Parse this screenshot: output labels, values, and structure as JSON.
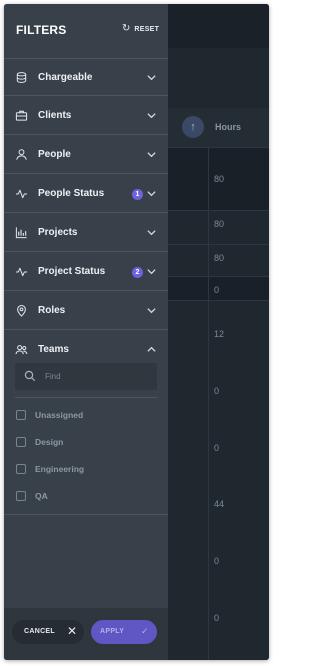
{
  "filters": {
    "title": "FILTERS",
    "reset_label": "RESET",
    "sections": [
      {
        "label": "Chargeable",
        "icon": "database-icon",
        "badge": null,
        "expanded": false
      },
      {
        "label": "Clients",
        "icon": "briefcase-icon",
        "badge": null,
        "expanded": false
      },
      {
        "label": "People",
        "icon": "person-icon",
        "badge": null,
        "expanded": false
      },
      {
        "label": "People Status",
        "icon": "activity-icon",
        "badge": "1",
        "expanded": false
      },
      {
        "label": "Projects",
        "icon": "bar-chart-icon",
        "badge": null,
        "expanded": false
      },
      {
        "label": "Project Status",
        "icon": "activity-icon",
        "badge": "2",
        "expanded": false
      },
      {
        "label": "Roles",
        "icon": "location-pin-icon",
        "badge": null,
        "expanded": false
      },
      {
        "label": "Teams",
        "icon": "people-icon",
        "badge": null,
        "expanded": true
      }
    ],
    "teams": {
      "search_placeholder": "Find",
      "search_value": "",
      "options": [
        {
          "label": "Unassigned",
          "checked": false
        },
        {
          "label": "Design",
          "checked": false
        },
        {
          "label": "Engineering",
          "checked": false
        },
        {
          "label": "QA",
          "checked": false
        }
      ]
    },
    "footer": {
      "cancel_label": "CANCEL",
      "apply_label": "APPLY"
    }
  },
  "background": {
    "column_header": "Hours",
    "hours_values": [
      "80",
      "80",
      "80",
      "0",
      "12",
      "0",
      "0",
      "44",
      "0",
      "0"
    ]
  },
  "colors": {
    "panel_bg": "#38414a",
    "accent": "#6f61e0",
    "apply_bg": "#5e57c4",
    "app_bg": "#1f272f"
  }
}
